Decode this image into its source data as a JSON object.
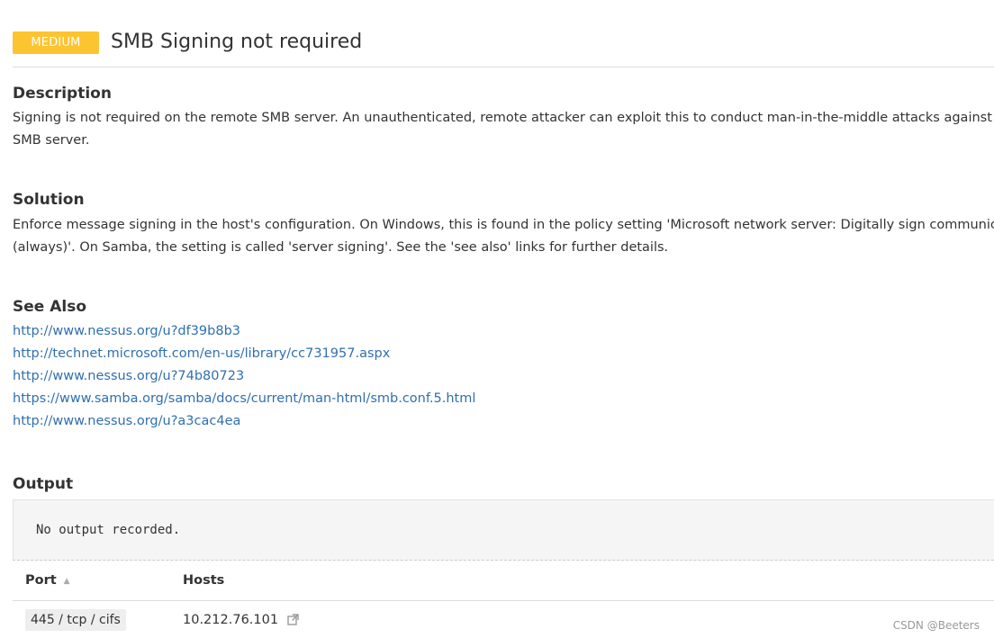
{
  "header": {
    "severity": "MEDIUM",
    "title": "SMB Signing not required",
    "severity_color": "#fdc431"
  },
  "description": {
    "heading": "Description",
    "lines": [
      "Signing is not required on the remote SMB server. An unauthenticated, remote attacker can exploit this to conduct man-in-the-middle attacks against th",
      "SMB server."
    ]
  },
  "solution": {
    "heading": "Solution",
    "lines": [
      "Enforce message signing in the host's configuration. On Windows, this is found in the policy setting 'Microsoft network server: Digitally sign communicat",
      "(always)'. On Samba, the setting is called 'server signing'. See the 'see also' links for further details."
    ]
  },
  "see_also": {
    "heading": "See Also",
    "links": [
      "http://www.nessus.org/u?df39b8b3",
      "http://technet.microsoft.com/en-us/library/cc731957.aspx",
      "http://www.nessus.org/u?74b80723",
      "https://www.samba.org/samba/docs/current/man-html/smb.conf.5.html",
      "http://www.nessus.org/u?a3cac4ea"
    ],
    "link_color": "#2f6fb0"
  },
  "output": {
    "heading": "Output",
    "text": "No output recorded."
  },
  "table": {
    "columns": [
      "Port",
      "Hosts"
    ],
    "rows": [
      {
        "port": "445 / tcp / cifs",
        "host": "10.212.76.101"
      }
    ]
  },
  "icons": {
    "sort": "sort-ascending-icon",
    "external": "external-link-icon"
  },
  "watermark": "CSDN @Beeters"
}
